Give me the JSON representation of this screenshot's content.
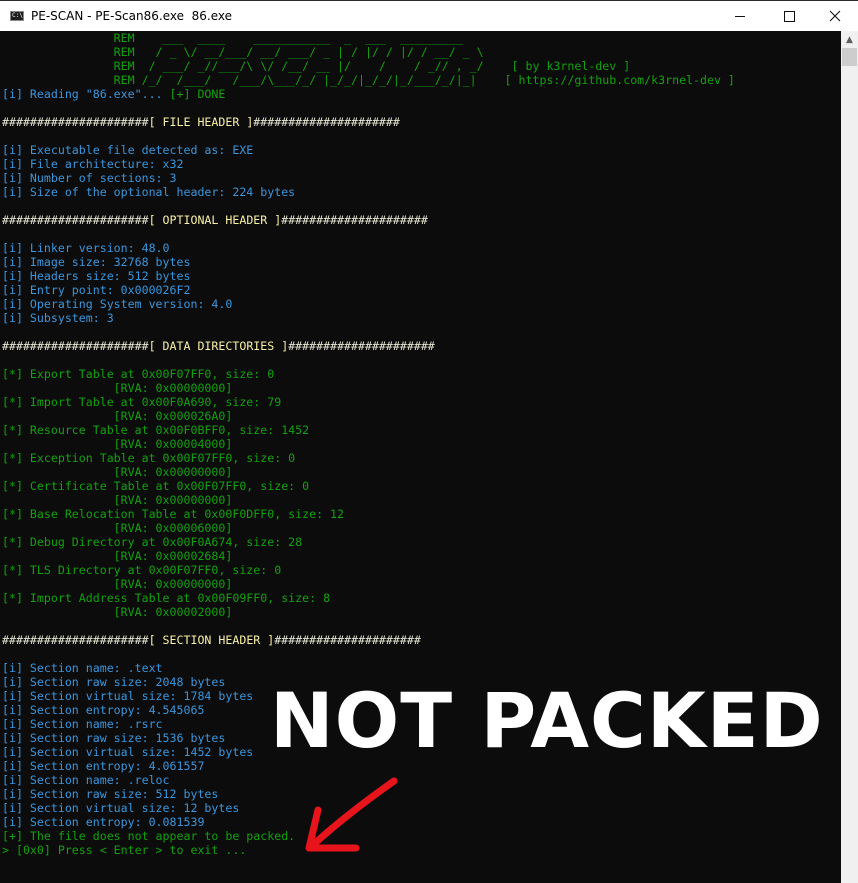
{
  "window": {
    "title": "PE-SCAN - PE-Scan86.exe  86.exe",
    "icon_label": "C:\\.",
    "controls": [
      "minimize",
      "maximize",
      "close"
    ]
  },
  "colors": {
    "green": "#13a10e",
    "cyan": "#3a96dd",
    "yellow": "#f9f1a5",
    "white": "#e6e6d2",
    "background": "#0c0c0c",
    "arrow": "#e8141b"
  },
  "overlay": {
    "text": "NOT PACKED",
    "arrow_icon": "red-arrow-pointing-down-left"
  },
  "lines": [
    [
      {
        "c": "green",
        "t": "                REM    ___  ____    ___________  _  ___  _________"
      }
    ],
    [
      {
        "c": "green",
        "t": "                REM   / _ \\/ __/___/ __/ ___/ _ | / |/ / |/ / __/ _ \\"
      }
    ],
    [
      {
        "c": "green",
        "t": "                REM  / ___/ _//___/\\ \\/ /__/ __ |/    /    / _// , _/    [ by k3rnel-dev ]"
      }
    ],
    [
      {
        "c": "green",
        "t": "                REM /_/  /___/   /___/\\___/_/ |_/_/|_/_/|_/___/_/|_|    [ https://github.com/k3rnel-dev ]"
      }
    ],
    [
      {
        "c": "cyan",
        "t": "[i] Reading \"86.exe\"... "
      },
      {
        "c": "green",
        "t": "[+] DONE"
      }
    ],
    [],
    [
      {
        "c": "white",
        "t": "#####################"
      },
      {
        "c": "yellow",
        "t": "[ FILE HEADER ]"
      },
      {
        "c": "white",
        "t": "#####################"
      }
    ],
    [],
    [
      {
        "c": "cyan",
        "t": "[i] Executable file detected as: EXE"
      }
    ],
    [
      {
        "c": "cyan",
        "t": "[i] File architecture: x32"
      }
    ],
    [
      {
        "c": "cyan",
        "t": "[i] Number of sections: 3"
      }
    ],
    [
      {
        "c": "cyan",
        "t": "[i] Size of the optional header: 224 bytes"
      }
    ],
    [],
    [
      {
        "c": "white",
        "t": "#####################"
      },
      {
        "c": "yellow",
        "t": "[ OPTIONAL HEADER ]"
      },
      {
        "c": "white",
        "t": "#####################"
      }
    ],
    [],
    [
      {
        "c": "cyan",
        "t": "[i] Linker version: 48.0"
      }
    ],
    [
      {
        "c": "cyan",
        "t": "[i] Image size: 32768 bytes"
      }
    ],
    [
      {
        "c": "cyan",
        "t": "[i] Headers size: 512 bytes"
      }
    ],
    [
      {
        "c": "cyan",
        "t": "[i] Entry point: 0x000026F2"
      }
    ],
    [
      {
        "c": "cyan",
        "t": "[i] Operating System version: 4.0"
      }
    ],
    [
      {
        "c": "cyan",
        "t": "[i] Subsystem: 3"
      }
    ],
    [],
    [
      {
        "c": "white",
        "t": "#####################"
      },
      {
        "c": "yellow",
        "t": "[ DATA DIRECTORIES ]"
      },
      {
        "c": "white",
        "t": "#####################"
      }
    ],
    [],
    [
      {
        "c": "green",
        "t": "[*] Export Table at 0x00F07FF0, size: 0"
      }
    ],
    [
      {
        "c": "green",
        "t": "                [RVA: 0x00000000]"
      }
    ],
    [
      {
        "c": "green",
        "t": "[*] Import Table at 0x00F0A690, size: 79"
      }
    ],
    [
      {
        "c": "green",
        "t": "                [RVA: 0x000026A0]"
      }
    ],
    [
      {
        "c": "green",
        "t": "[*] Resource Table at 0x00F0BFF0, size: 1452"
      }
    ],
    [
      {
        "c": "green",
        "t": "                [RVA: 0x00004000]"
      }
    ],
    [
      {
        "c": "green",
        "t": "[*] Exception Table at 0x00F07FF0, size: 0"
      }
    ],
    [
      {
        "c": "green",
        "t": "                [RVA: 0x00000000]"
      }
    ],
    [
      {
        "c": "green",
        "t": "[*] Certificate Table at 0x00F07FF0, size: 0"
      }
    ],
    [
      {
        "c": "green",
        "t": "                [RVA: 0x00000000]"
      }
    ],
    [
      {
        "c": "green",
        "t": "[*] Base Relocation Table at 0x00F0DFF0, size: 12"
      }
    ],
    [
      {
        "c": "green",
        "t": "                [RVA: 0x00006000]"
      }
    ],
    [
      {
        "c": "green",
        "t": "[*] Debug Directory at 0x00F0A674, size: 28"
      }
    ],
    [
      {
        "c": "green",
        "t": "                [RVA: 0x00002684]"
      }
    ],
    [
      {
        "c": "green",
        "t": "[*] TLS Directory at 0x00F07FF0, size: 0"
      }
    ],
    [
      {
        "c": "green",
        "t": "                [RVA: 0x00000000]"
      }
    ],
    [
      {
        "c": "green",
        "t": "[*] Import Address Table at 0x00F09FF0, size: 8"
      }
    ],
    [
      {
        "c": "green",
        "t": "                [RVA: 0x00002000]"
      }
    ],
    [],
    [
      {
        "c": "white",
        "t": "#####################"
      },
      {
        "c": "yellow",
        "t": "[ SECTION HEADER ]"
      },
      {
        "c": "white",
        "t": "#####################"
      }
    ],
    [],
    [
      {
        "c": "cyan",
        "t": "[i] Section name: .text"
      }
    ],
    [
      {
        "c": "cyan",
        "t": "[i] Section raw size: 2048 bytes"
      }
    ],
    [
      {
        "c": "cyan",
        "t": "[i] Section virtual size: 1784 bytes"
      }
    ],
    [
      {
        "c": "cyan",
        "t": "[i] Section entropy: 4.545065"
      }
    ],
    [
      {
        "c": "cyan",
        "t": "[i] Section name: .rsrc"
      }
    ],
    [
      {
        "c": "cyan",
        "t": "[i] Section raw size: 1536 bytes"
      }
    ],
    [
      {
        "c": "cyan",
        "t": "[i] Section virtual size: 1452 bytes"
      }
    ],
    [
      {
        "c": "cyan",
        "t": "[i] Section entropy: 4.061557"
      }
    ],
    [
      {
        "c": "cyan",
        "t": "[i] Section name: .reloc"
      }
    ],
    [
      {
        "c": "cyan",
        "t": "[i] Section raw size: 512 bytes"
      }
    ],
    [
      {
        "c": "cyan",
        "t": "[i] Section virtual size: 12 bytes"
      }
    ],
    [
      {
        "c": "cyan",
        "t": "[i] Section entropy: 0.081539"
      }
    ],
    [
      {
        "c": "green",
        "t": "[+] The file does not appear to be packed."
      }
    ],
    [
      {
        "c": "green",
        "t": "> [0x0] Press < Enter > to exit ..."
      }
    ]
  ]
}
